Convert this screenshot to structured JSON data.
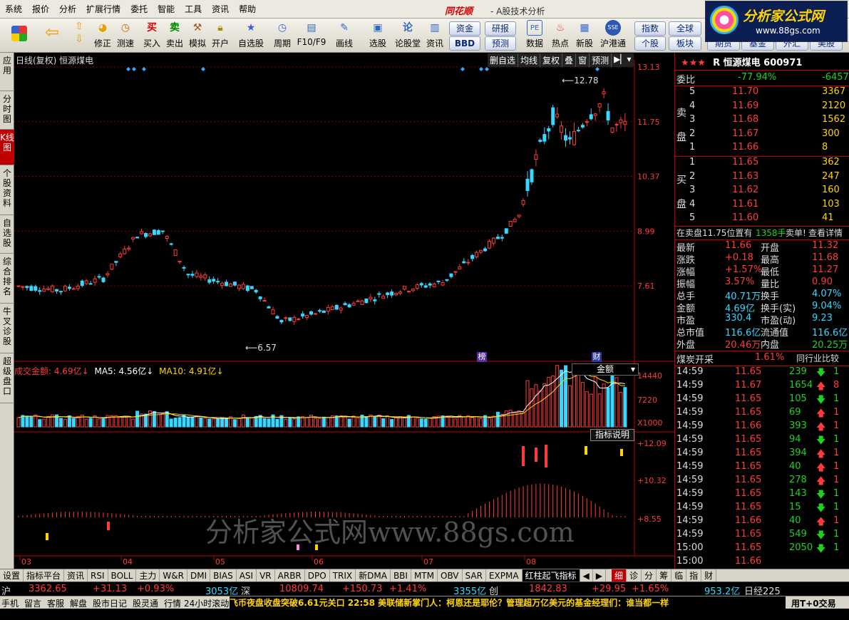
{
  "menu": {
    "items": [
      "系统",
      "报价",
      "分析",
      "扩展行情",
      "委托",
      "智能",
      "工具",
      "资讯",
      "帮助"
    ],
    "brand": "同花顺",
    "subtitle": "- A股技术分析"
  },
  "logo": {
    "title": "分析家公式网",
    "url": "www.88gs.com"
  },
  "toolbar": {
    "buttons": [
      "修正",
      "测速",
      "买入",
      "卖出",
      "模拟",
      "开户",
      "自选股",
      "周期",
      "F10/F9",
      "画线",
      "选股",
      "论股堂",
      "资讯",
      "数据",
      "热点",
      "新股",
      "沪港通"
    ],
    "small": [
      "资金",
      "研报",
      "BBD",
      "预测",
      "指数",
      "全球",
      "个股",
      "板块",
      "期货",
      "基金",
      "外汇",
      "美股"
    ]
  },
  "lefttabs": [
    "应用",
    "分时图",
    "K线图",
    "个股资料",
    "自选股",
    "综合排名",
    "牛叉诊股",
    "超级盘口"
  ],
  "chart_header": {
    "left": "日线(复权) 恒源煤电",
    "buttons": [
      "删自选",
      "均线",
      "复权",
      "叠",
      "窗",
      "预测"
    ]
  },
  "price_axis": [
    "13.13",
    "11.75",
    "10.37",
    "8.99",
    "7.61"
  ],
  "annotations": {
    "high": "12.78",
    "low": "6.57",
    "tag1": "榜",
    "tag2": "财"
  },
  "volume": {
    "label": "成交金额: 4.69亿↓",
    "ma5": "MA5: 4.56亿↓",
    "ma10": "MA10: 4.91亿↓",
    "selector": "金额",
    "axis": [
      "14440",
      "7220",
      "X1000"
    ],
    "help": "指标说明"
  },
  "indicator": {
    "axis": [
      "+12.09",
      "+10.32",
      "+8.55"
    ]
  },
  "watermark": "分析家公式网www.88gs.com",
  "months": [
    "03",
    "04",
    "05",
    "06",
    "07",
    "08"
  ],
  "stock": {
    "stars": "★★★",
    "title": "R 恒源煤电 600971",
    "weibi_label": "委比",
    "weibi": "-77.94%",
    "weicha": "-6457",
    "sell_label": "卖盘",
    "buy_label": "买盘",
    "sell": [
      {
        "n": "5",
        "p": "11.70",
        "v": "3367"
      },
      {
        "n": "4",
        "p": "11.69",
        "v": "2120"
      },
      {
        "n": "3",
        "p": "11.68",
        "v": "1562"
      },
      {
        "n": "2",
        "p": "11.67",
        "v": "300"
      },
      {
        "n": "1",
        "p": "11.66",
        "v": "8"
      }
    ],
    "buy": [
      {
        "n": "1",
        "p": "11.65",
        "v": "362"
      },
      {
        "n": "2",
        "p": "11.63",
        "v": "247"
      },
      {
        "n": "3",
        "p": "11.62",
        "v": "160"
      },
      {
        "n": "4",
        "p": "11.61",
        "v": "103"
      },
      {
        "n": "5",
        "p": "11.60",
        "v": "41"
      }
    ],
    "notice": {
      "a": "在卖盘11.75位置有",
      "b": "1358手",
      "c": "卖单!",
      "d": "查看详情"
    },
    "quote": [
      {
        "l1": "最新",
        "v1": "11.66",
        "l2": "开盘",
        "v2": "11.32"
      },
      {
        "l1": "涨跌",
        "v1": "+0.18",
        "l2": "最高",
        "v2": "11.68"
      },
      {
        "l1": "涨幅",
        "v1": "+1.57%",
        "l2": "最低",
        "v2": "11.27"
      },
      {
        "l1": "振幅",
        "v1": "3.57%",
        "l2": "量比",
        "v2": "0.90"
      },
      {
        "l1": "总手",
        "v1": "40.71万",
        "l2": "换手",
        "v2": "4.07%"
      },
      {
        "l1": "金额",
        "v1": "4.69亿",
        "l2": "换手(实)",
        "v2": "9.04%"
      },
      {
        "l1": "市盈",
        "v1": "330.4",
        "l2": "市盈(动)",
        "v2": "9.23"
      },
      {
        "l1": "总市值",
        "v1": "116.6亿",
        "l2": "流通值",
        "v2": "116.6亿"
      },
      {
        "l1": "外盘",
        "v1": "20.46万",
        "l2": "内盘",
        "v2": "20.25万"
      }
    ],
    "sector": {
      "name": "煤炭开采",
      "chg": "1.61%",
      "compare": "同行业比较"
    },
    "ticks": [
      {
        "t": "14:59",
        "p": "11.65",
        "v": "239",
        "d": "dn",
        "x": "1"
      },
      {
        "t": "14:59",
        "p": "11.67",
        "v": "1654",
        "d": "up",
        "x": "8"
      },
      {
        "t": "14:59",
        "p": "11.65",
        "v": "105",
        "d": "dn",
        "x": "1"
      },
      {
        "t": "14:59",
        "p": "11.65",
        "v": "69",
        "d": "up",
        "x": "1"
      },
      {
        "t": "14:59",
        "p": "11.66",
        "v": "393",
        "d": "up",
        "x": "1"
      },
      {
        "t": "14:59",
        "p": "11.65",
        "v": "94",
        "d": "dn",
        "x": "1"
      },
      {
        "t": "14:59",
        "p": "11.65",
        "v": "394",
        "d": "up",
        "x": "1"
      },
      {
        "t": "14:59",
        "p": "11.65",
        "v": "40",
        "d": "up",
        "x": "1"
      },
      {
        "t": "14:59",
        "p": "11.65",
        "v": "278",
        "d": "up",
        "x": "1"
      },
      {
        "t": "14:59",
        "p": "11.65",
        "v": "143",
        "d": "dn",
        "x": "1"
      },
      {
        "t": "14:59",
        "p": "11.65",
        "v": "15",
        "d": "dn",
        "x": "1"
      },
      {
        "t": "14:59",
        "p": "11.66",
        "v": "40",
        "d": "up",
        "x": "1"
      },
      {
        "t": "14:59",
        "p": "11.65",
        "v": "549",
        "d": "dn",
        "x": "1"
      },
      {
        "t": "15:00",
        "p": "11.65",
        "v": "2050",
        "d": "dn",
        "x": "1"
      },
      {
        "t": "15:00",
        "p": "11.66",
        "v": "",
        "d": "",
        "x": ""
      }
    ]
  },
  "bottom_tabs": [
    "设置",
    "指标平台",
    "资讯",
    "RSI",
    "BOLL",
    "主力",
    "W&R",
    "DMI",
    "BIAS",
    "ASI",
    "VR",
    "ARBR",
    "DPO",
    "TRIX",
    "新DMA",
    "BBI",
    "MTM",
    "OBV",
    "SAR",
    "EXPMA",
    "红柱起飞指标"
  ],
  "right_tabs": [
    "细",
    "诊",
    "分",
    "筹",
    "临",
    "指",
    "财"
  ],
  "index": {
    "sh_label": "沪",
    "sh": "3362.65",
    "sh_chg": "+31.13",
    "sh_pct": "+0.93%",
    "sh_amt": "3053亿",
    "sz_label": "深",
    "sz": "10809.74",
    "sz_chg": "+150.73",
    "sz_pct": "+1.41%",
    "sz_amt": "3355亿",
    "cy_label": "创",
    "cy": "1842.83",
    "cy_chg": "+29.95",
    "cy_pct": "+1.65%",
    "cy_amt": "953.2亿",
    "rj_label": "日经225"
  },
  "status": {
    "items": [
      "手机",
      "留言",
      "客服",
      "解盘",
      "股市日记",
      "股灵通",
      "行情",
      "24小时滚动"
    ],
    "ticker": "飞币夜盘收盘突破6.61元关口    22:58 美联储新掌门人：柯恩还是耶伦？管理超万亿美元的基金经理们：谁当都一样",
    "right": "用T+0交易"
  }
}
